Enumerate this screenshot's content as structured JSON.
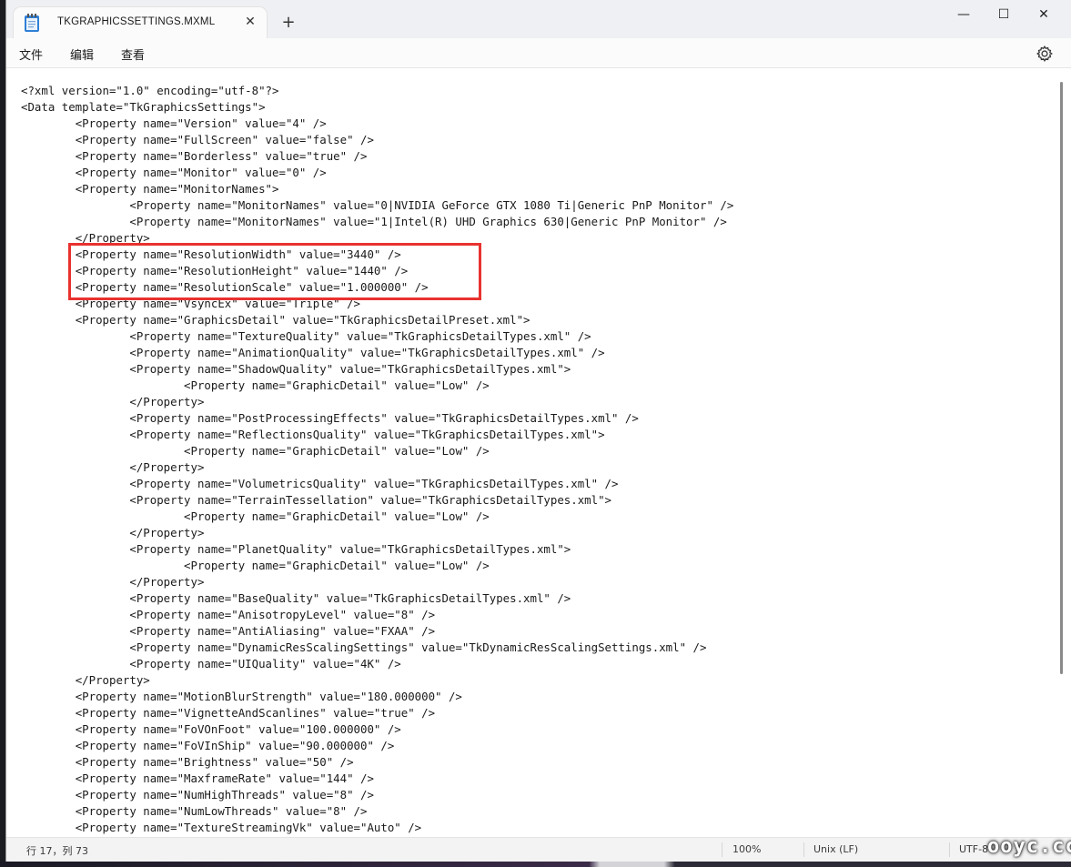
{
  "window": {
    "tab_title": "TKGRAPHICSSETTINGS.MXML",
    "tab_close": "✕",
    "new_tab": "+",
    "minimize": "—",
    "maximize": "☐",
    "close": "✕"
  },
  "menu": {
    "file": "文件",
    "edit": "编辑",
    "view": "查看"
  },
  "editor": {
    "lines": [
      "<?xml version=\"1.0\" encoding=\"utf-8\"?>",
      "<Data template=\"TkGraphicsSettings\">",
      "\t<Property name=\"Version\" value=\"4\" />",
      "\t<Property name=\"FullScreen\" value=\"false\" />",
      "\t<Property name=\"Borderless\" value=\"true\" />",
      "\t<Property name=\"Monitor\" value=\"0\" />",
      "\t<Property name=\"MonitorNames\">",
      "\t\t<Property name=\"MonitorNames\" value=\"0|NVIDIA GeForce GTX 1080 Ti|Generic PnP Monitor\" />",
      "\t\t<Property name=\"MonitorNames\" value=\"1|Intel(R) UHD Graphics 630|Generic PnP Monitor\" />",
      "\t</Property>",
      "\t<Property name=\"ResolutionWidth\" value=\"3440\" />",
      "\t<Property name=\"ResolutionHeight\" value=\"1440\" />",
      "\t<Property name=\"ResolutionScale\" value=\"1.000000\" />",
      "\t<Property name=\"VsyncEx\" value=\"Triple\" />",
      "\t<Property name=\"GraphicsDetail\" value=\"TkGraphicsDetailPreset.xml\">",
      "\t\t<Property name=\"TextureQuality\" value=\"TkGraphicsDetailTypes.xml\" />",
      "\t\t<Property name=\"AnimationQuality\" value=\"TkGraphicsDetailTypes.xml\" />",
      "\t\t<Property name=\"ShadowQuality\" value=\"TkGraphicsDetailTypes.xml\">",
      "\t\t\t<Property name=\"GraphicDetail\" value=\"Low\" />",
      "\t\t</Property>",
      "\t\t<Property name=\"PostProcessingEffects\" value=\"TkGraphicsDetailTypes.xml\" />",
      "\t\t<Property name=\"ReflectionsQuality\" value=\"TkGraphicsDetailTypes.xml\">",
      "\t\t\t<Property name=\"GraphicDetail\" value=\"Low\" />",
      "\t\t</Property>",
      "\t\t<Property name=\"VolumetricsQuality\" value=\"TkGraphicsDetailTypes.xml\" />",
      "\t\t<Property name=\"TerrainTessellation\" value=\"TkGraphicsDetailTypes.xml\">",
      "\t\t\t<Property name=\"GraphicDetail\" value=\"Low\" />",
      "\t\t</Property>",
      "\t\t<Property name=\"PlanetQuality\" value=\"TkGraphicsDetailTypes.xml\">",
      "\t\t\t<Property name=\"GraphicDetail\" value=\"Low\" />",
      "\t\t</Property>",
      "\t\t<Property name=\"BaseQuality\" value=\"TkGraphicsDetailTypes.xml\" />",
      "\t\t<Property name=\"AnisotropyLevel\" value=\"8\" />",
      "\t\t<Property name=\"AntiAliasing\" value=\"FXAA\" />",
      "\t\t<Property name=\"DynamicResScalingSettings\" value=\"TkDynamicResScalingSettings.xml\" />",
      "\t\t<Property name=\"UIQuality\" value=\"4K\" />",
      "\t</Property>",
      "\t<Property name=\"MotionBlurStrength\" value=\"180.000000\" />",
      "\t<Property name=\"VignetteAndScanlines\" value=\"true\" />",
      "\t<Property name=\"FoVOnFoot\" value=\"100.000000\" />",
      "\t<Property name=\"FoVInShip\" value=\"90.000000\" />",
      "\t<Property name=\"Brightness\" value=\"50\" />",
      "\t<Property name=\"MaxframeRate\" value=\"144\" />",
      "\t<Property name=\"NumHighThreads\" value=\"8\" />",
      "\t<Property name=\"NumLowThreads\" value=\"8\" />",
      "\t<Property name=\"TextureStreamingVk\" value=\"Auto\" />"
    ]
  },
  "status": {
    "position": "行 17，列 73",
    "zoom": "100%",
    "line_ending": "Unix (LF)",
    "encoding": "UTF-8"
  },
  "watermark": "ooyc.cc",
  "colors": {
    "highlight": "#e8322e",
    "window_bg": "#f3f3f3",
    "editor_bg": "#ffffff"
  }
}
